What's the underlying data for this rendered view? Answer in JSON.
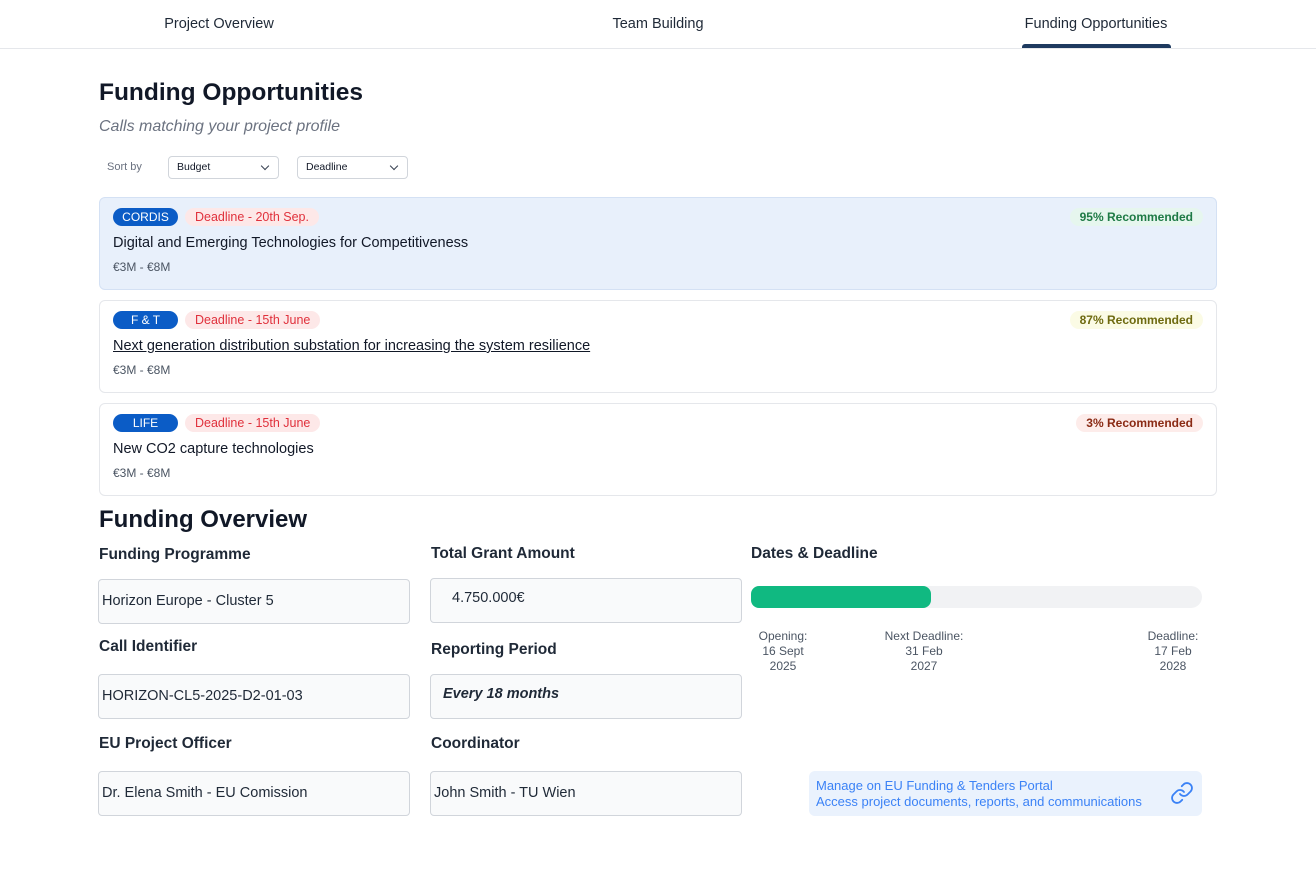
{
  "tabs": [
    {
      "label": "Project Overview"
    },
    {
      "label": "Team Building"
    },
    {
      "label": "Funding Opportunities",
      "active": true
    }
  ],
  "header": {
    "title": "Funding Opportunities",
    "subtitle": "Calls matching your project profile"
  },
  "sort": {
    "label": "Sort by",
    "options": [
      "Budget",
      "Deadline"
    ]
  },
  "calls": [
    {
      "source": "CORDIS",
      "deadline": "Deadline - 20th Sep.",
      "recommended": "95% Recommended",
      "title": "Digital and Emerging Technologies for Competitiveness",
      "amount": "€3M - €8M"
    },
    {
      "source": "F & T",
      "deadline": "Deadline - 15th June",
      "recommended": "87% Recommended",
      "title": "Next generation distribution substation for increasing the system resilience",
      "amount": "€3M - €8M"
    },
    {
      "source": "LIFE",
      "deadline": "Deadline - 15th June",
      "recommended": "3% Recommended",
      "title": "New CO2 capture technologies",
      "amount": "€3M - €8M"
    }
  ],
  "overview": {
    "title": "Funding Overview",
    "funding_programme": {
      "label": "Funding Programme",
      "value": "Horizon Europe - Cluster 5"
    },
    "call_identifier": {
      "label": "Call Identifier",
      "value": "HORIZON-CL5-2025-D2-01-03"
    },
    "project_officer": {
      "label": "EU Project Officer",
      "value": "Dr. Elena Smith - EU Comission"
    },
    "total_grant": {
      "label": "Total Grant Amount",
      "value": "4.750.000€"
    },
    "reporting_period": {
      "label": "Reporting Period",
      "value": "Every 18 months"
    },
    "coordinator": {
      "label": "Coordinator",
      "value": "John Smith - TU Wien"
    },
    "dates": {
      "label": "Dates & Deadline",
      "progress_percent": 40,
      "opening": {
        "label": "Opening:",
        "day": "16 Sept",
        "year": "2025"
      },
      "next_deadline": {
        "label": "Next Deadline:",
        "day": "31 Feb",
        "year": "2027"
      },
      "deadline": {
        "label": "Deadline:",
        "day": "17 Feb",
        "year": "2028"
      }
    },
    "portal": {
      "title": "Manage on EU Funding & Tenders Portal",
      "description": "Access project documents, reports, and communications"
    }
  },
  "colors": {
    "accent": "#1e3a5f",
    "badge_blue": "#0b5cc6",
    "progress_green": "#10b981",
    "deadline_red": "#e0313c",
    "link_blue": "#3b82f6"
  }
}
